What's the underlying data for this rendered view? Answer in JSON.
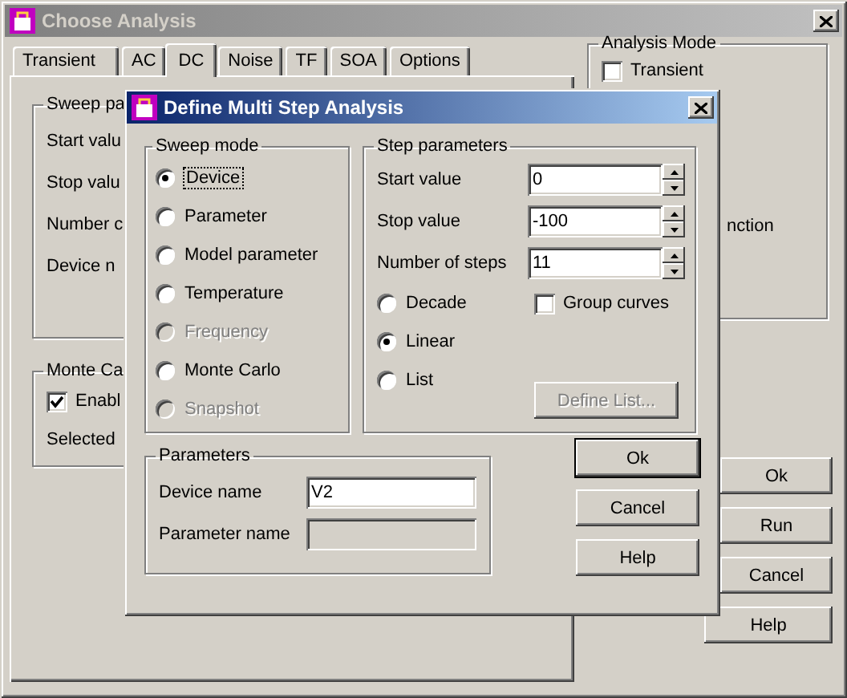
{
  "window": {
    "title": "Choose Analysis"
  },
  "tabs": [
    {
      "label": "Transient",
      "selected": false
    },
    {
      "label": "AC",
      "selected": false
    },
    {
      "label": "DC",
      "selected": true
    },
    {
      "label": "Noise",
      "selected": false
    },
    {
      "label": "TF",
      "selected": false
    },
    {
      "label": "SOA",
      "selected": false
    },
    {
      "label": "Options",
      "selected": false
    }
  ],
  "sweep_group": {
    "title": "Sweep pa",
    "labels": [
      "Start valu",
      "Stop valu",
      "Number c",
      "Device n"
    ]
  },
  "monte_carlo_group": {
    "title": "Monte Ca",
    "enable": {
      "label": "Enabl",
      "checked": true
    },
    "selected_label": "Selected"
  },
  "analysis_mode": {
    "title": "Analysis Mode",
    "transient": {
      "label": "Transient",
      "checked": false
    },
    "partial_label": "nction"
  },
  "buttons": [
    "Ok",
    "Run",
    "Cancel",
    "Help"
  ],
  "dialog": {
    "title": "Define Multi Step Analysis",
    "sweep_mode": {
      "title": "Sweep mode",
      "options": [
        {
          "label": "Device",
          "selected": true,
          "disabled": false
        },
        {
          "label": "Parameter",
          "selected": false,
          "disabled": false
        },
        {
          "label": "Model parameter",
          "selected": false,
          "disabled": false
        },
        {
          "label": "Temperature",
          "selected": false,
          "disabled": false
        },
        {
          "label": "Frequency",
          "selected": false,
          "disabled": true
        },
        {
          "label": "Monte Carlo",
          "selected": false,
          "disabled": false
        },
        {
          "label": "Snapshot",
          "selected": false,
          "disabled": true
        }
      ]
    },
    "step_parameters": {
      "title": "Step parameters",
      "fields": [
        {
          "label": "Start value",
          "value": "0"
        },
        {
          "label": "Stop value",
          "value": "-100"
        },
        {
          "label": "Number of steps",
          "value": "11"
        }
      ],
      "scales": [
        {
          "label": "Decade",
          "selected": false
        },
        {
          "label": "Linear",
          "selected": true
        },
        {
          "label": "List",
          "selected": false
        }
      ],
      "group_curves": {
        "label": "Group curves",
        "checked": false
      },
      "define_list": {
        "label": "Define List...",
        "disabled": true
      }
    },
    "parameters": {
      "title": "Parameters",
      "fields": [
        {
          "label": "Device name",
          "value": "V2",
          "disabled": false
        },
        {
          "label": "Parameter name",
          "disabled": true
        }
      ]
    },
    "buttons": [
      "Ok",
      "Cancel",
      "Help"
    ]
  }
}
